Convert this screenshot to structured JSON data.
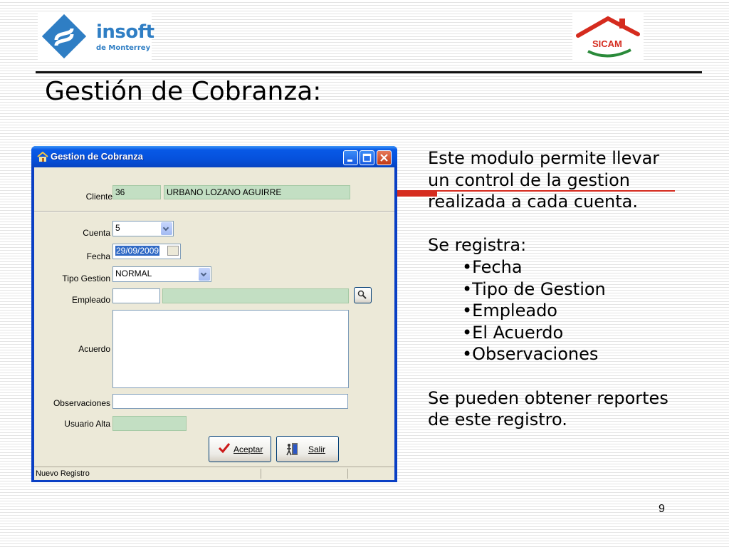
{
  "slide": {
    "title": "Gestión de Cobranza:",
    "page_number": "9"
  },
  "logos": {
    "left": {
      "name": "insoft",
      "sub": "de Monterrey"
    },
    "right": {
      "name": "SICAM"
    }
  },
  "window": {
    "title": "Gestion de Cobranza",
    "form": {
      "cliente_label": "Cliente",
      "cliente_id": "36",
      "cliente_name": "URBANO LOZANO AGUIRRE",
      "cuenta_label": "Cuenta",
      "cuenta_value": "5",
      "fecha_label": "Fecha",
      "fecha_value": "29/09/2009",
      "tipo_label": "Tipo Gestion",
      "tipo_value": "NORMAL",
      "empleado_label": "Empleado",
      "empleado_id": "",
      "empleado_name": "",
      "acuerdo_label": "Acuerdo",
      "acuerdo_value": "",
      "observaciones_label": "Observaciones",
      "observaciones_value": "",
      "usuario_label": "Usuario Alta",
      "usuario_value": ""
    },
    "buttons": {
      "aceptar": "Aceptar",
      "salir": "Salir"
    },
    "status": "Nuevo Registro"
  },
  "description": {
    "intro": "Este modulo permite llevar un control de la gestion realizada a cada cuenta.",
    "registra_heading": "Se registra:",
    "items": [
      "•Fecha",
      "•Tipo de Gestion",
      "•Empleado",
      "•El Acuerdo",
      "•Observaciones"
    ],
    "outro": "Se pueden obtener reportes de este registro."
  },
  "colors": {
    "accent_red": "#d52b1e",
    "xp_blue": "#0651dc",
    "field_green": "#c3dfc3",
    "logo_blue": "#2f7ec4"
  }
}
